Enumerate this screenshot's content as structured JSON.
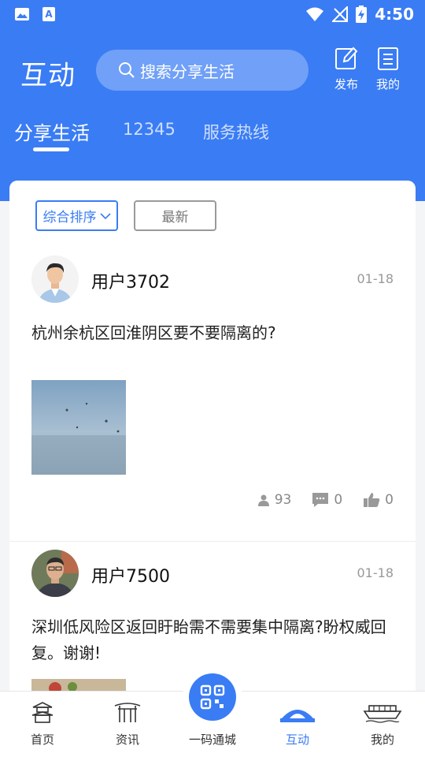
{
  "status_bar": {
    "time": "4:50"
  },
  "header": {
    "title": "互动",
    "search_placeholder": "搜索分享生活",
    "publish_label": "发布",
    "mine_label": "我的"
  },
  "tabs": [
    {
      "label": "分享生活"
    },
    {
      "label": "12345"
    },
    {
      "label": "服务热线"
    }
  ],
  "sort": {
    "active_label": "综合排序",
    "inactive_label": "最新"
  },
  "posts": [
    {
      "username": "用户3702",
      "date": "01-18",
      "content": "杭州余杭区回淮阴区要不要隔离的?",
      "views": "93",
      "comments": "0",
      "likes": "0"
    },
    {
      "username": "用户7500",
      "date": "01-18",
      "content": "深圳低风险区返回盱眙需不需要集中隔离?盼权威回复。谢谢!"
    }
  ],
  "bottom_nav": {
    "home": "首页",
    "news": "资讯",
    "center": "一码通城",
    "interact": "互动",
    "mine": "我的"
  },
  "colors": {
    "accent": "#3a7cf4"
  }
}
